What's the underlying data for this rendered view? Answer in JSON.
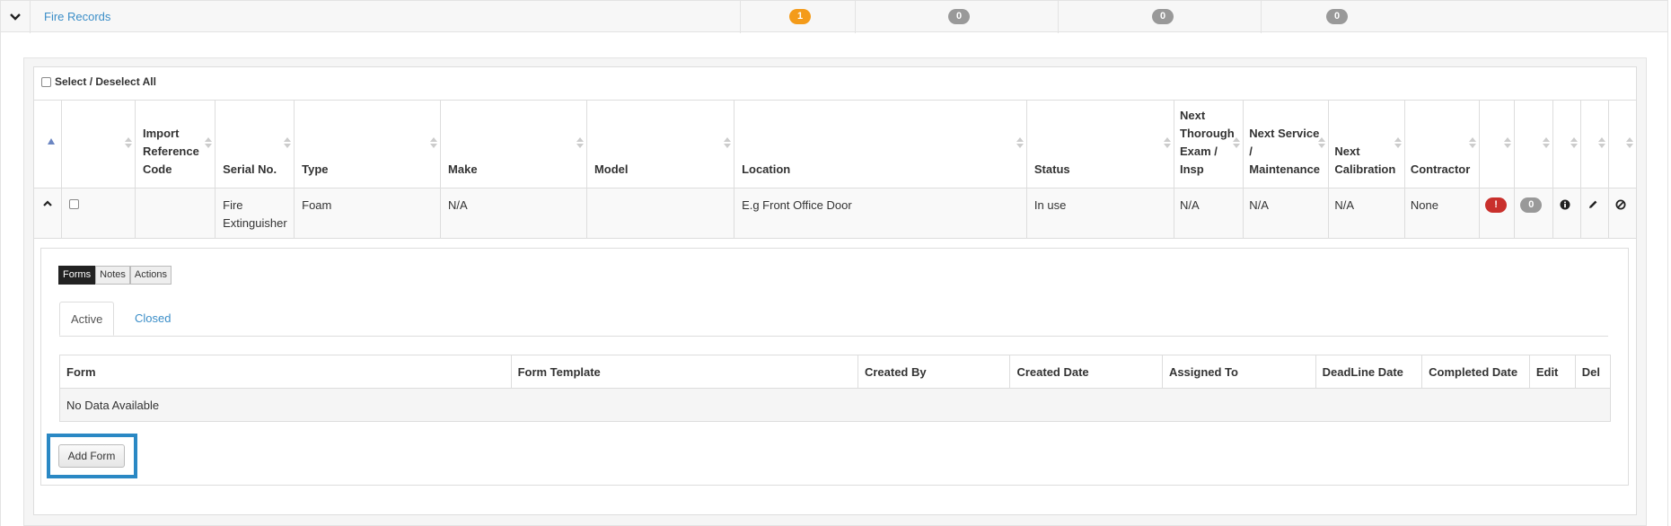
{
  "section": {
    "title": "Fire Records",
    "counts": [
      "1",
      "0",
      "0",
      "0"
    ]
  },
  "select_all_label": "Select / Deselect All",
  "main_table": {
    "headers": [
      "",
      "",
      "Import Reference Code",
      "Serial No.",
      "Type",
      "Make",
      "Model",
      "Location",
      "Status",
      "Next Thorough Exam / Insp",
      "Next Service / Maintenance",
      "Next Calibration",
      "Contractor",
      "",
      "",
      "",
      "",
      ""
    ],
    "row": {
      "import_ref": "",
      "serial_no": "Fire Extinguisher",
      "type": "Foam",
      "make": "N/A",
      "model": "",
      "location": "E.g Front Office Door",
      "status": "In use",
      "next_thorough": "N/A",
      "next_service": "N/A",
      "next_calibration": "N/A",
      "contractor": "None",
      "alert_badge": "!",
      "count_badge": "0"
    }
  },
  "detail": {
    "button_group": [
      "Forms",
      "Notes",
      "Actions"
    ],
    "tabs": [
      "Active",
      "Closed"
    ],
    "forms_table": {
      "headers": [
        "Form",
        "Form Template",
        "Created By",
        "Created Date",
        "Assigned To",
        "DeadLine Date",
        "Completed Date",
        "Edit",
        "Del"
      ],
      "empty_text": "No Data Available"
    },
    "add_form_label": "Add Form"
  },
  "colors": {
    "link": "#3b8ec8",
    "badge_orange": "#f49b1a",
    "badge_grey": "#999999",
    "badge_red": "#c9302c",
    "highlight": "#2a88c4"
  },
  "icons": [
    "chevron-down-icon",
    "sort-icon",
    "chevron-up-icon",
    "info-icon",
    "pencil-icon",
    "ban-icon"
  ]
}
